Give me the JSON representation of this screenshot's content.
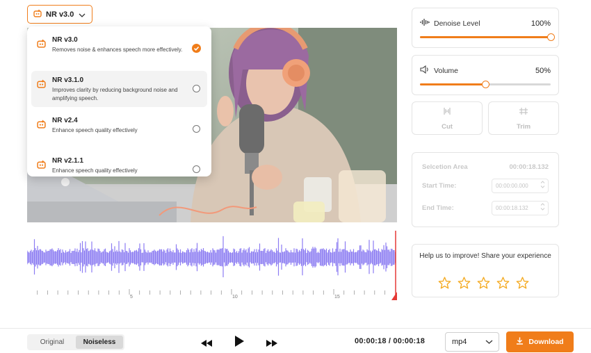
{
  "model_selector": {
    "selected_label": "NR v3.0"
  },
  "models": [
    {
      "title": "NR v3.0",
      "desc": "Removes noise & enhances speech more effectively.",
      "selected": true
    },
    {
      "title": "NR v3.1.0",
      "desc": "Improves clarity by reducing background noise and amplifying speech.",
      "selected": false
    },
    {
      "title": "NR v2.4",
      "desc": "Enhance speech quality effectively",
      "selected": false
    },
    {
      "title": "NR v2.1.1",
      "desc": "Enhance speech quality effectively",
      "selected": false
    }
  ],
  "denoise": {
    "label": "Denoise Level",
    "value": "100%",
    "level": 1.0
  },
  "volume": {
    "label": "Volume",
    "value": "50%",
    "level": 0.5
  },
  "tools": {
    "cut_label": "Cut",
    "trim_label": "Trim"
  },
  "selection": {
    "area_label": "Selcetion Area",
    "area_value": "00:00:18.132",
    "start_label": "Start Time:",
    "start_value": "00:00:00.000",
    "end_label": "End Time:",
    "end_value": "00:00:18.132"
  },
  "waveform": {
    "tick_labels": [
      "5",
      "10",
      "15"
    ]
  },
  "feedback": {
    "question": "Help us to improve! Share your experience",
    "stars": 5
  },
  "playback": {
    "original_label": "Original",
    "noiseless_label": "Noiseless",
    "active_mode": "Noiseless",
    "timecode": "00:00:18 / 00:00:18"
  },
  "export": {
    "format": "mp4",
    "download_label": "Download"
  },
  "colors": {
    "accent": "#f07d1a",
    "waveform": "#8c7cf2",
    "playhead": "#e53935"
  }
}
